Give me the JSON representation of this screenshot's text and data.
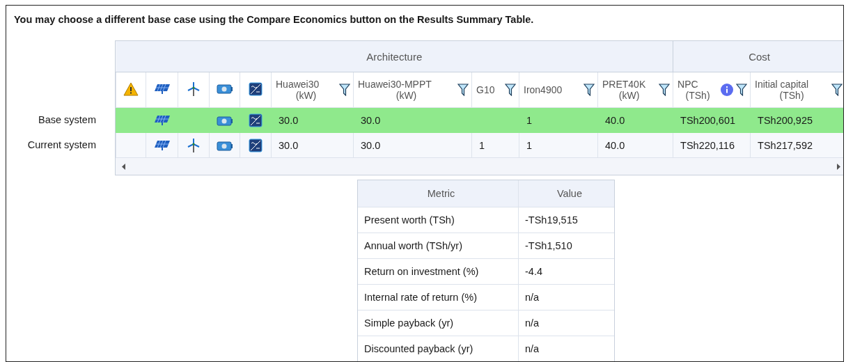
{
  "instruction": "You may choose a different base case using the Compare Economics button on the Results Summary Table.",
  "comparison": {
    "groups": [
      {
        "title": "Architecture",
        "columns": [
          {
            "kind": "warning"
          },
          {
            "kind": "pv"
          },
          {
            "kind": "wind"
          },
          {
            "kind": "battery"
          },
          {
            "kind": "converter"
          },
          {
            "kind": "value",
            "label": "Huawei30",
            "unit": "(kW)",
            "info": false
          },
          {
            "kind": "value",
            "label": "Huawei30-MPPT",
            "unit": "(kW)",
            "info": false
          },
          {
            "kind": "value",
            "label": "G10",
            "info": false
          },
          {
            "kind": "value",
            "label": "Iron4900",
            "info": false
          },
          {
            "kind": "value",
            "label": "PRET40K",
            "unit": "(kW)",
            "info": false
          }
        ]
      },
      {
        "title": "Cost",
        "columns": [
          {
            "kind": "value",
            "label": "NPC",
            "unit": "(TSh)",
            "info": true
          },
          {
            "kind": "value",
            "label": "Initial capital",
            "unit": "(TSh)",
            "info": false
          }
        ]
      }
    ],
    "rows": [
      {
        "label": "Base system",
        "highlighted": true,
        "components": {
          "pv": true,
          "wind": false,
          "battery": true,
          "converter": true
        },
        "cells": [
          {
            "text": "30.0"
          },
          {
            "text": "30.0"
          },
          {},
          {
            "text": "1"
          },
          {
            "text": "40.0"
          },
          {
            "text": "TSh200,601"
          },
          {
            "text": "TSh200,925"
          }
        ]
      },
      {
        "label": "Current system",
        "highlighted": false,
        "components": {
          "pv": true,
          "wind": true,
          "battery": true,
          "converter": true
        },
        "cells": [
          {
            "text": "30.0"
          },
          {
            "text": "30.0"
          },
          {
            "text": "1"
          },
          {
            "text": "1"
          },
          {
            "text": "40.0"
          },
          {
            "text": "TSh220,116"
          },
          {
            "text": "TSh217,592"
          }
        ]
      }
    ]
  },
  "metrics": {
    "columns": [
      "Metric",
      "Value"
    ],
    "rows": [
      {
        "metric": "Present worth (TSh)",
        "value": "-TSh19,515"
      },
      {
        "metric": "Annual worth (TSh/yr)",
        "value": "-TSh1,510"
      },
      {
        "metric": "Return on investment (%)",
        "value": "-4.4"
      },
      {
        "metric": "Internal rate of return (%)",
        "value": "n/a"
      },
      {
        "metric": "Simple payback (yr)",
        "value": "n/a"
      },
      {
        "metric": "Discounted payback (yr)",
        "value": "n/a"
      }
    ]
  }
}
